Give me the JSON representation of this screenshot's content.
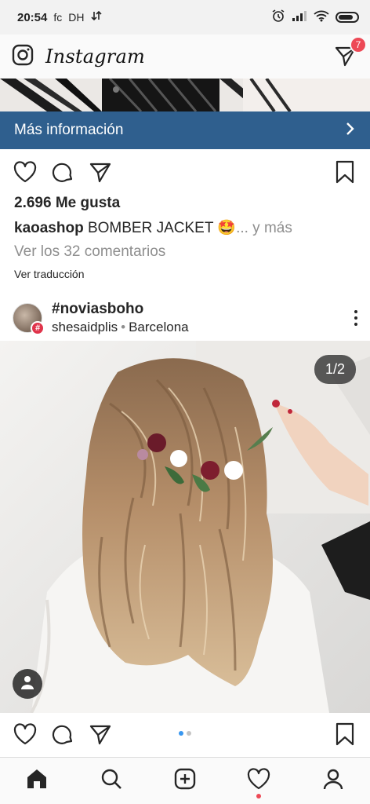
{
  "status_bar": {
    "time": "20:54",
    "left_extra": "fc",
    "left_extra2": "DH"
  },
  "header": {
    "logo": "Instagram",
    "dm_badge": "7"
  },
  "previous_post": {
    "more_info_label": "Más información",
    "likes": "2.696 Me gusta",
    "caption_user": "kaoashop",
    "caption_text": "BOMBER JACKET 🤩",
    "caption_more": "... y más",
    "comments_link": "Ver los 32 comentarios",
    "translate_link": "Ver traducción"
  },
  "post": {
    "hashtag": "#noviasboho",
    "username": "shesaidplis",
    "separator": "•",
    "location": "Barcelona",
    "avatar_tag": "#",
    "photo_counter": "1/2",
    "carousel": {
      "total": 2,
      "active": 1
    }
  },
  "icons": {
    "camera": "camera-icon",
    "direct": "paper-plane-icon",
    "like": "heart-icon",
    "comment": "comment-icon",
    "share": "paper-plane-icon",
    "save": "bookmark-icon",
    "home": "home-icon",
    "search": "search-icon",
    "add": "add-post-icon",
    "activity": "heart-icon",
    "profile": "profile-icon"
  },
  "colors": {
    "accent_blue": "#2f5f8e",
    "badge_red": "#ed4956",
    "dot_active": "#3897f0"
  }
}
